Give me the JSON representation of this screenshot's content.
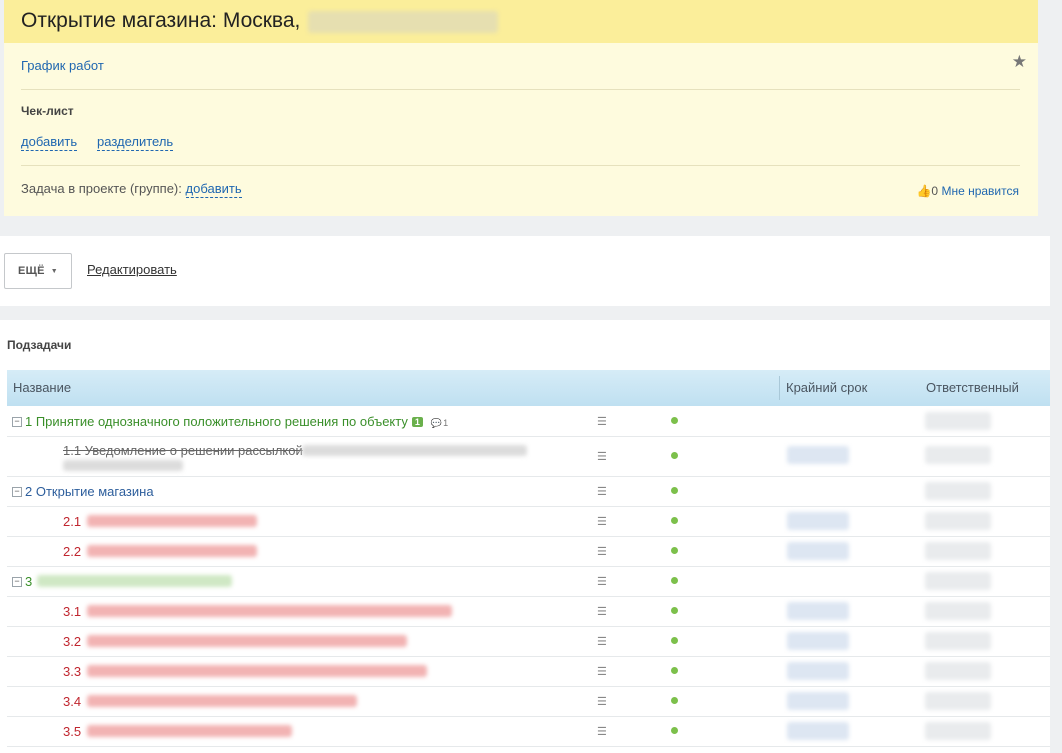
{
  "task": {
    "title": "Открытие магазина: Москва,",
    "schedule_link": "График работ",
    "checklist_title": "Чек-лист",
    "add_label": "добавить",
    "divider_label": "разделитель",
    "project_label": "Задача в проекте (группе):",
    "project_add_label": "добавить",
    "likes_count": "0",
    "likes_label": "Мне нравится"
  },
  "actions": {
    "more_label": "ЕЩЁ",
    "edit_label": "Редактировать"
  },
  "subtasks": {
    "title": "Подзадачи",
    "columns": {
      "name": "Название",
      "deadline": "Крайний срок",
      "responsible": "Ответственный"
    },
    "groups": [
      {
        "label": "1 Принятие однозначного положительного решения по объекту",
        "badge": "1",
        "comments": "1",
        "done_child": "1.1 Уведомление о решении рассылкой"
      },
      {
        "label": "2 Открытие магазина",
        "children": [
          "2.1",
          "2.2"
        ]
      },
      {
        "label": "3",
        "children": [
          "3.1",
          "3.2",
          "3.3",
          "3.4",
          "3.5"
        ]
      }
    ]
  },
  "colors": {
    "header_bar": "#fbee9a",
    "card_bg": "#fefbde",
    "link": "#2067b0",
    "status_green": "#7cc04b",
    "overdue_red": "#c0262f"
  }
}
